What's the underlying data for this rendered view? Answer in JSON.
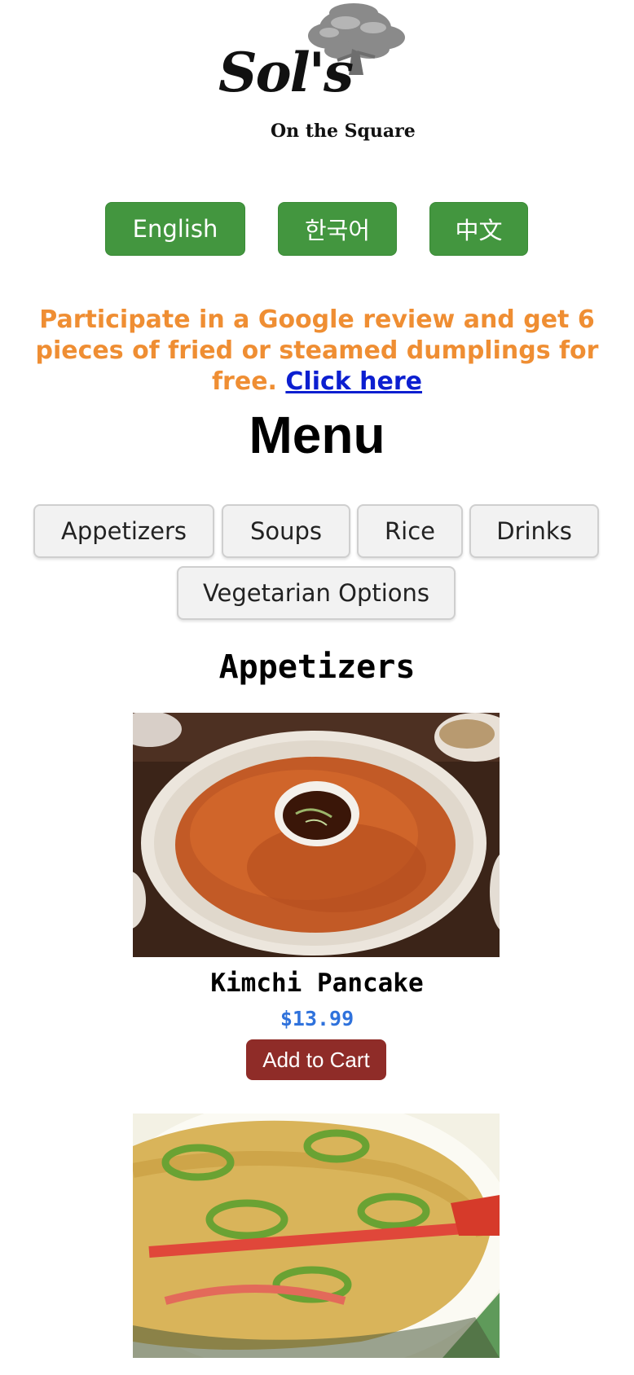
{
  "logo": {
    "brand": "Sol's",
    "tagline": "On the Square"
  },
  "languages": [
    "English",
    "한국어",
    "中文"
  ],
  "promo": {
    "text": "Participate in a Google review and get 6 pieces of fried or steamed dumplings for free.",
    "link_text": "Click here"
  },
  "menu": {
    "title": "Menu",
    "categories": [
      "Appetizers",
      "Soups",
      "Rice",
      "Drinks",
      "Vegetarian Options"
    ],
    "section_title": "Appetizers"
  },
  "items": [
    {
      "name": "Kimchi Pancake",
      "price": "$13.99",
      "button": "Add to Cart",
      "photo": "kimchi-pancake-photo"
    },
    {
      "photo": "seafood-pancake-photo"
    }
  ],
  "colors": {
    "lang_button": "#43963f",
    "promo_text": "#ef8e33",
    "link": "#0c1fd0",
    "price": "#2f72dc",
    "cart_button": "#8f2c28"
  }
}
